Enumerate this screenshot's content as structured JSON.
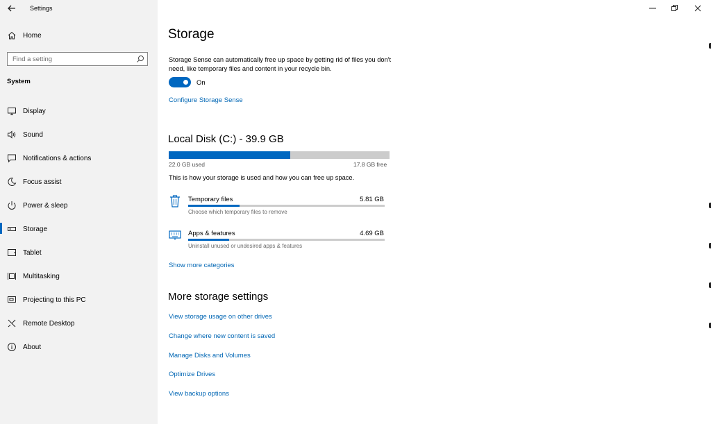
{
  "window": {
    "app_title": "Settings",
    "back_icon": "back-arrow-icon",
    "controls": [
      "minimize-icon",
      "restore-icon",
      "close-icon"
    ]
  },
  "sidebar": {
    "home_label": "Home",
    "search_placeholder": "Find a setting",
    "section_label": "System",
    "items": [
      {
        "label": "Display",
        "icon": "display-icon"
      },
      {
        "label": "Sound",
        "icon": "speaker-icon"
      },
      {
        "label": "Notifications & actions",
        "icon": "notification-icon"
      },
      {
        "label": "Focus assist",
        "icon": "moon-icon"
      },
      {
        "label": "Power & sleep",
        "icon": "power-icon"
      },
      {
        "label": "Storage",
        "icon": "storage-icon",
        "active": true
      },
      {
        "label": "Tablet",
        "icon": "tablet-icon"
      },
      {
        "label": "Multitasking",
        "icon": "multitasking-icon"
      },
      {
        "label": "Projecting to this PC",
        "icon": "projecting-icon"
      },
      {
        "label": "Remote Desktop",
        "icon": "remote-desktop-icon"
      },
      {
        "label": "About",
        "icon": "info-icon"
      }
    ]
  },
  "main": {
    "title": "Storage",
    "description": "Storage Sense can automatically free up space by getting rid of files you don't need, like temporary files and content in your recycle bin.",
    "storage_sense": {
      "state": "On",
      "on": true
    },
    "configure_link": "Configure Storage Sense",
    "disk": {
      "title": "Local Disk (C:) - 39.9 GB",
      "used_label": "22.0 GB used",
      "free_label": "17.8 GB free",
      "used_fraction": 0.55
    },
    "info_text": "This is how your storage is used and how you can free up space.",
    "categories": [
      {
        "name": "Temporary files",
        "size": "5.81 GB",
        "description": "Choose which temporary files to remove",
        "icon": "trash-icon",
        "fraction": 0.26
      },
      {
        "name": "Apps & features",
        "size": "4.69 GB",
        "description": "Uninstall unused or undesired apps & features",
        "icon": "keyboard-icon",
        "fraction": 0.21
      }
    ],
    "show_more_link": "Show more categories",
    "more_title": "More storage settings",
    "more_links": [
      "View storage usage on other drives",
      "Change where new content is saved",
      "Manage Disks and Volumes",
      "Optimize Drives",
      "View backup options"
    ]
  },
  "colors": {
    "accent": "#0067c0",
    "link": "#0066b4",
    "sidebar_bg": "#f2f2f2",
    "bar_track": "#cccccc"
  }
}
